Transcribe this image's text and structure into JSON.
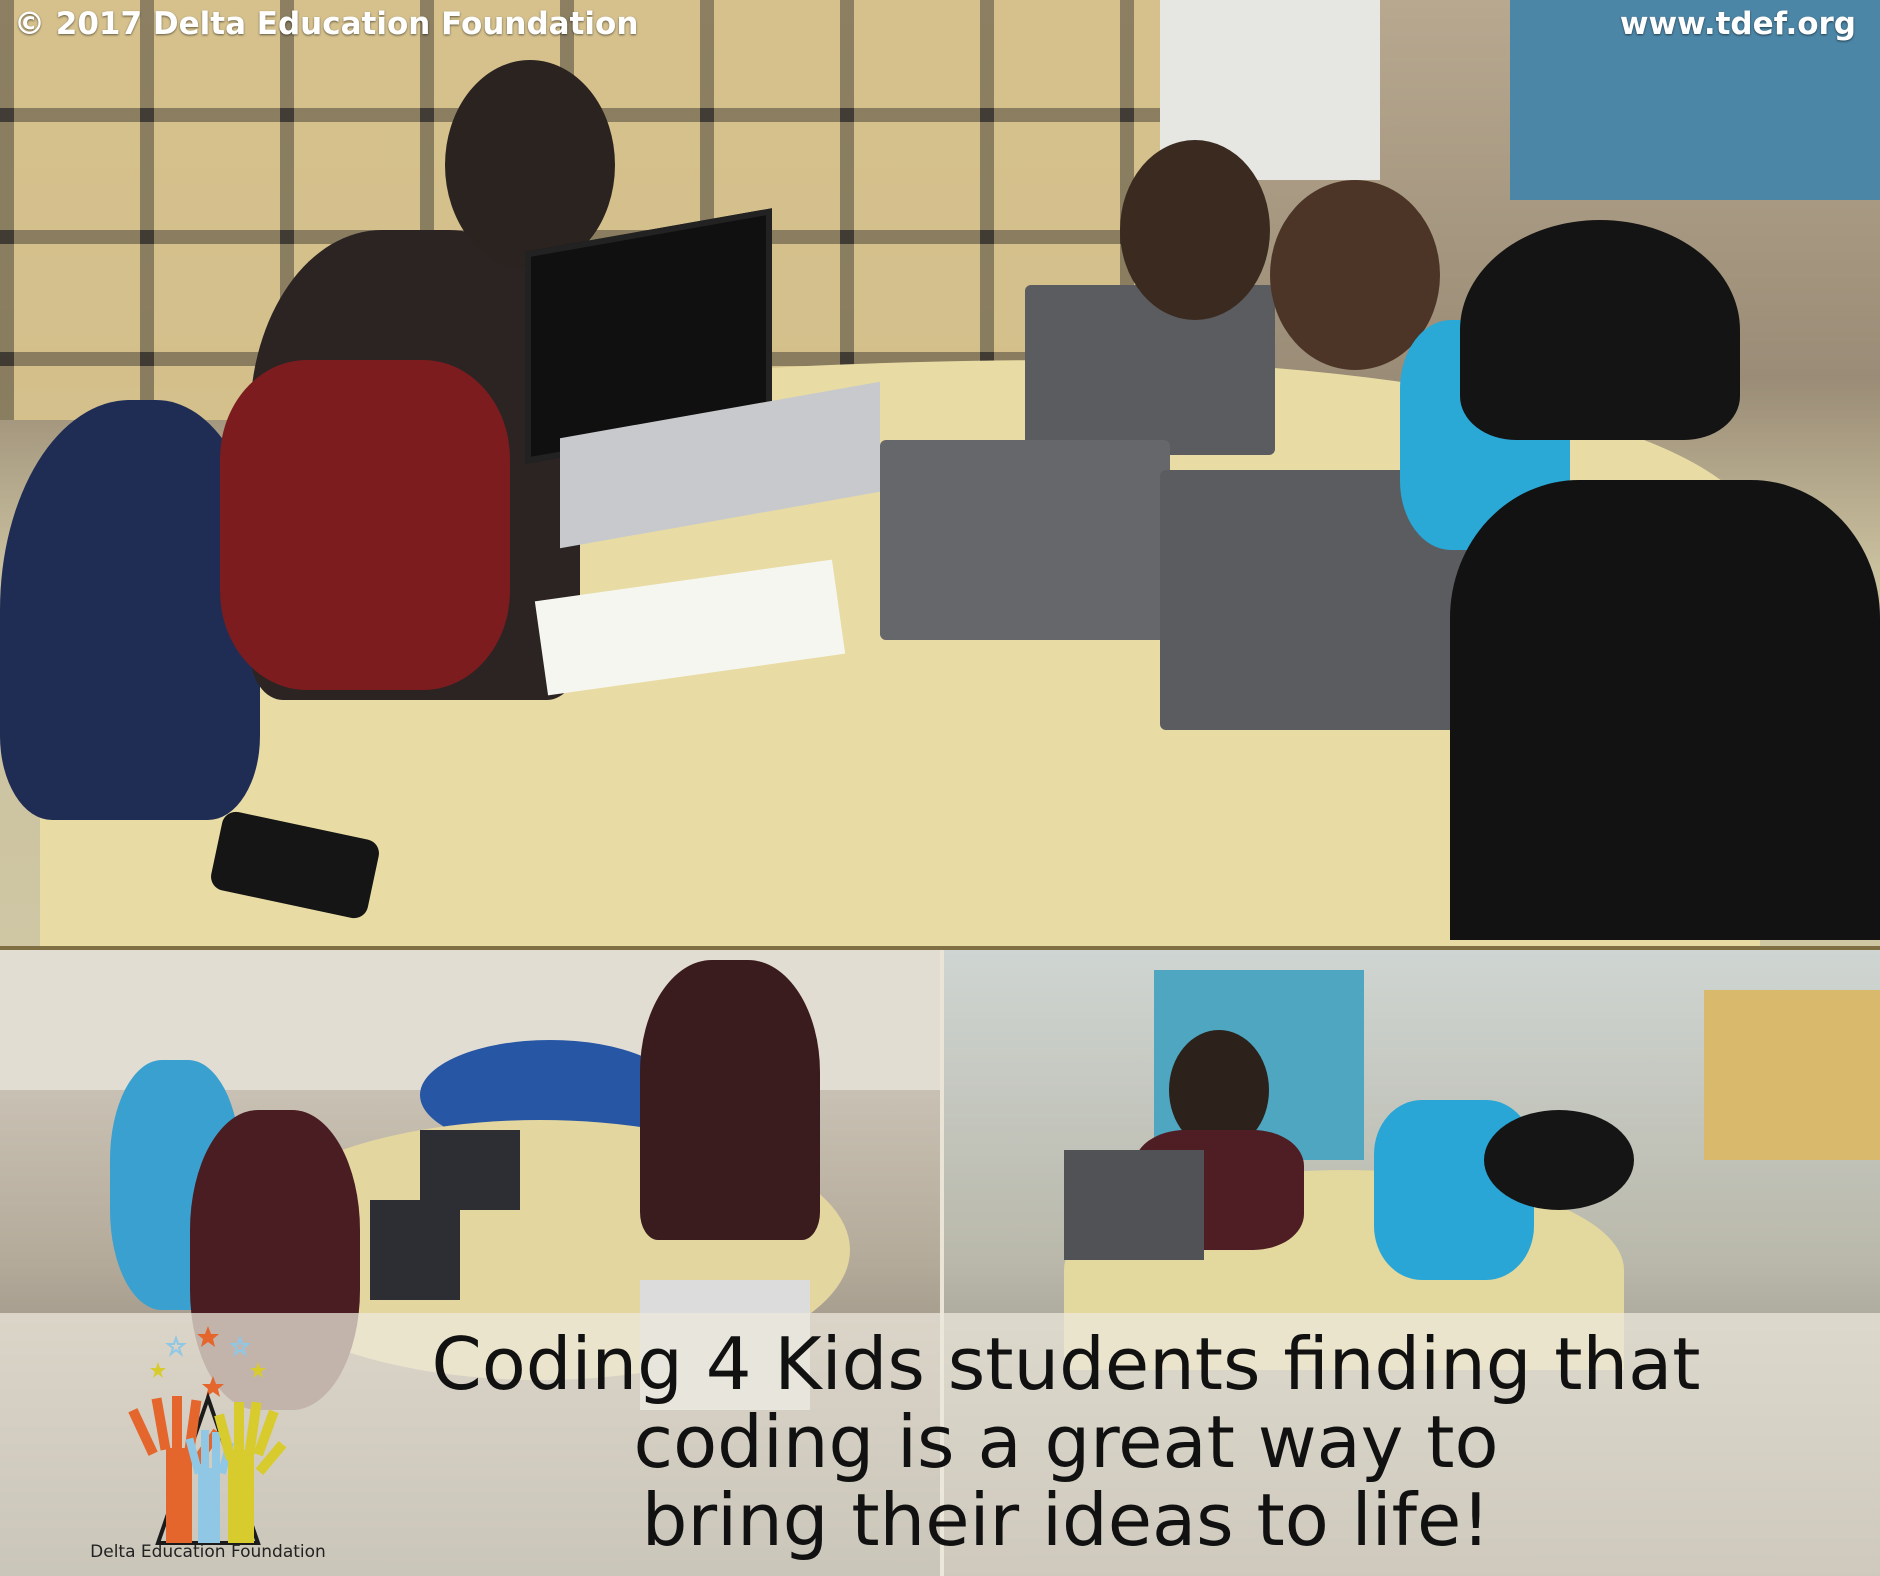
{
  "watermark": {
    "copyright": "© 2017 Delta Education Foundation",
    "url": "www.tdef.org"
  },
  "caption": {
    "lines": [
      "Coding 4 Kids students finding that",
      "coding is a great way to",
      "bring their ideas to life!"
    ]
  },
  "logo": {
    "name": "Delta Education Foundation",
    "colors": [
      "#e4662c",
      "#8fc7e5",
      "#d8cb2e",
      "#1b1b1b"
    ]
  },
  "colors": {
    "caption_band": "#ece8dc",
    "divider": "#7f6f42"
  }
}
